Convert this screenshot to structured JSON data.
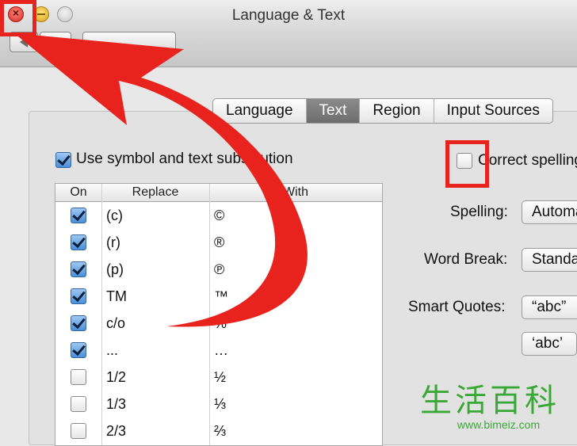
{
  "window": {
    "title": "Language & Text"
  },
  "tabs": [
    "Language",
    "Text",
    "Region",
    "Input Sources"
  ],
  "active_tab": "Text",
  "substitution": {
    "label": "Use symbol and text substitution",
    "checked": true
  },
  "table": {
    "headers": [
      "On",
      "Replace",
      "With"
    ],
    "rows": [
      {
        "on": true,
        "replace": "(c)",
        "with": "©"
      },
      {
        "on": true,
        "replace": "(r)",
        "with": "®"
      },
      {
        "on": true,
        "replace": "(p)",
        "with": "℗"
      },
      {
        "on": true,
        "replace": "TM",
        "with": "™"
      },
      {
        "on": true,
        "replace": "c/o",
        "with": "℅"
      },
      {
        "on": true,
        "replace": "...",
        "with": "…"
      },
      {
        "on": false,
        "replace": "1/2",
        "with": "½"
      },
      {
        "on": false,
        "replace": "1/3",
        "with": "⅓"
      },
      {
        "on": false,
        "replace": "2/3",
        "with": "⅔"
      }
    ]
  },
  "spelling_option": {
    "label": "Correct spelling automatically",
    "checked": false
  },
  "settings": {
    "spelling_label": "Spelling:",
    "spelling_value": "Automatic by Language",
    "word_break_label": "Word Break:",
    "word_break_value": "Standard",
    "smart_quotes_label": "Smart Quotes:",
    "smart_quotes_double": "“abc”",
    "smart_quotes_single": "‘abc’"
  },
  "watermark": {
    "text": "生活百科",
    "url": "www.bimeiz.com"
  },
  "colors": {
    "annotation_red": "#e8221c",
    "checkbox_blue": "#4a8fdc",
    "watermark_green": "#3aa837"
  }
}
